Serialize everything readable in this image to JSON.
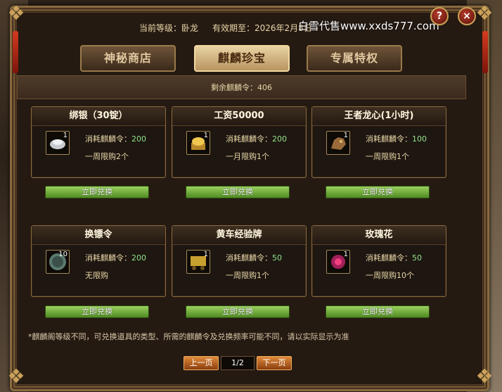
{
  "header": {
    "level_label": "当前等级：卧龙",
    "expiry_label": "有效期至：2026年2月8日",
    "watermark": "白雪代售www.xxds777.com",
    "help_icon": "?",
    "close_icon": "×"
  },
  "tabs": [
    {
      "label": "神秘商店",
      "active": false
    },
    {
      "label": "麒麟珍宝",
      "active": true
    },
    {
      "label": "专属特权",
      "active": false
    }
  ],
  "remaining": "剩余麒麟令：406",
  "items": [
    {
      "title": "绑银（30锭）",
      "icon": "silver-ingot-icon",
      "count": "1",
      "cost_label": "消耗麒麟令：",
      "cost": "200",
      "limit": "一周限购2个",
      "button": "立即兑换"
    },
    {
      "title": "工资50000",
      "icon": "gold-treasure-icon",
      "count": "1",
      "cost_label": "消耗麒麟令：",
      "cost": "200",
      "limit": "一月限购1个",
      "button": "立即兑换"
    },
    {
      "title": "王者龙心(1小时)",
      "icon": "dragon-heart-icon",
      "count": "1",
      "cost_label": "消耗麒麟令：",
      "cost": "100",
      "limit": "一周限购1个",
      "button": "立即兑换"
    },
    {
      "title": "换镖令",
      "icon": "escort-token-icon",
      "count": "10",
      "cost_label": "消耗麒麟令：",
      "cost": "200",
      "limit": "无限购",
      "button": "立即兑换"
    },
    {
      "title": "黄车经验牌",
      "icon": "cart-exp-plaque-icon",
      "count": "1",
      "cost_label": "消耗麒麟令：",
      "cost": "50",
      "limit": "一周限购1个",
      "button": "立即兑换"
    },
    {
      "title": "玫瑰花",
      "icon": "rose-icon",
      "count": "1",
      "cost_label": "消耗麒麟令：",
      "cost": "50",
      "limit": "一周限购10个",
      "button": "立即兑换"
    }
  ],
  "note": "*麒麟阁等级不同，可兑换道具的类型、所需的麒麟令及兑换频率可能不同，请以实际显示为准",
  "pagination": {
    "prev": "上一页",
    "indicator": "1/2",
    "next": "下一页"
  },
  "colors": {
    "cost_value": "#8fe38a",
    "redeem_button": "#6fae36",
    "page_button": "#c8702a",
    "frame_gold": "#8a6a3e"
  }
}
